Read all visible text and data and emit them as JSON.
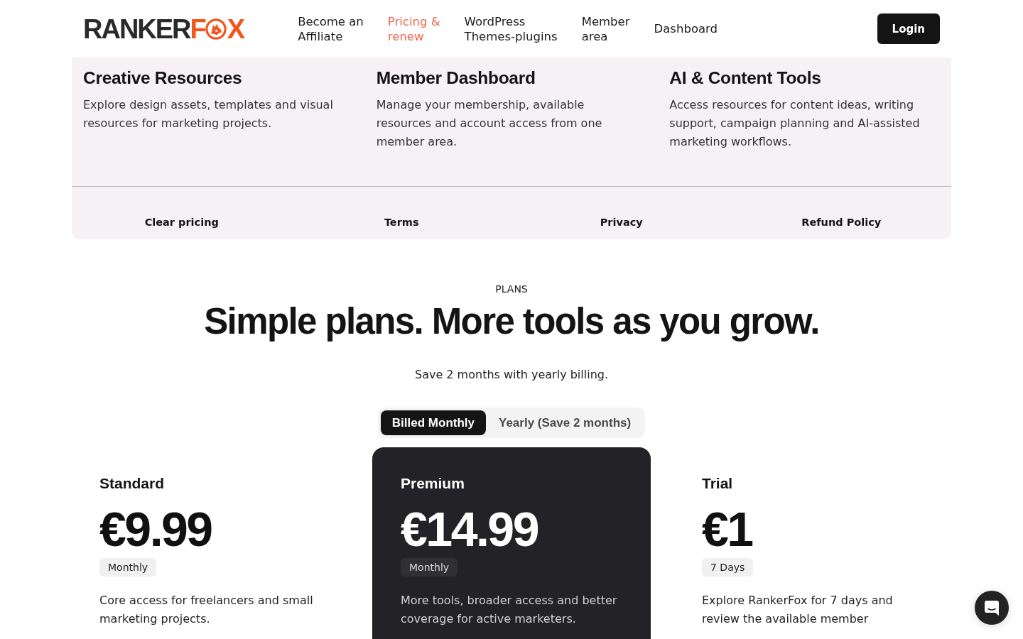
{
  "header": {
    "logo": {
      "parts": [
        {
          "kind": "dark",
          "text": "RANKER"
        },
        {
          "kind": "accent",
          "text": "F"
        },
        {
          "kind": "fox"
        },
        {
          "kind": "accent",
          "text": "X"
        }
      ]
    },
    "nav": [
      {
        "lines": [
          "Become an",
          "Affiliate"
        ],
        "selected": false
      },
      {
        "lines": [
          "Pricing &",
          "renew"
        ],
        "selected": true
      },
      {
        "lines": [
          "WordPress",
          "Themes-plugins"
        ],
        "selected": false
      },
      {
        "lines": [
          "Member",
          "area"
        ],
        "selected": false
      },
      {
        "lines": [
          "Dashboard"
        ],
        "selected": false
      }
    ],
    "login_button": "Login"
  },
  "dropdown": {
    "columns": [
      {
        "title": "Creative Resources",
        "description": "Explore design assets, templates and visual resources for marketing projects."
      },
      {
        "title": "Member Dashboard",
        "description": "Manage your membership, available resources and account access from one member area."
      },
      {
        "title": "AI & Content Tools",
        "description": "Access resources for content ideas, writing support, campaign planning and AI-assisted marketing workflows."
      }
    ],
    "links": [
      "Clear pricing",
      "Terms",
      "Privacy",
      "Refund Policy"
    ]
  },
  "plans": {
    "eyebrow": "PLANS",
    "title": "Simple plans. More tools as you grow.",
    "subtitle": "Save 2 months with yearly billing.",
    "billing_toggle": [
      {
        "label": "Billed Monthly",
        "selected": true
      },
      {
        "label": "Yearly (Save 2 months)",
        "selected": false
      }
    ],
    "cards": [
      {
        "name": "Standard",
        "price": "€9.99",
        "period": "Monthly",
        "description": "Core access for freelancers and small marketing projects.",
        "featured": false
      },
      {
        "name": "Premium",
        "price": "€14.99",
        "period": "Monthly",
        "description": "More tools, broader access and better coverage for active marketers.",
        "featured": true
      },
      {
        "name": "Trial",
        "price": "€1",
        "period": "7 Days",
        "description": "Explore RankerFox for 7 days and review the available member",
        "featured": false
      }
    ]
  }
}
